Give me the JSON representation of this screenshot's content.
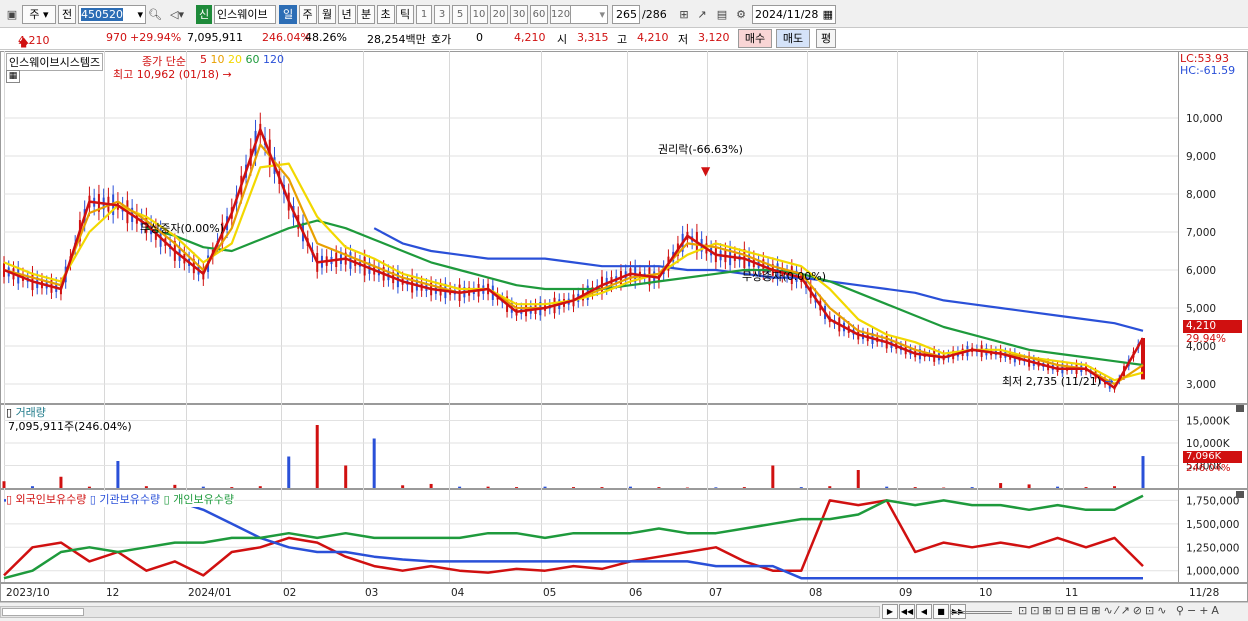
{
  "toolbar": {
    "market_select": "주",
    "prev_btn": "전",
    "code_value": "450520",
    "stock_badge": "신",
    "stock_name": "인스웨이브",
    "periods": [
      "일",
      "주",
      "월",
      "년",
      "분",
      "초",
      "틱"
    ],
    "period_selected": "일",
    "intervals": [
      "1",
      "3",
      "5",
      "10",
      "20",
      "30",
      "60",
      "120"
    ],
    "count": "265",
    "total": "/286",
    "date": "2024/11/28"
  },
  "quote": {
    "price": "4,210",
    "change": "970",
    "change_pct": "+29.94%",
    "volume": "7,095,911",
    "vol_ratio": "246.04%",
    "turnover": "48.26%",
    "amount": "28,254백만",
    "bid_label": "호가",
    "bid_val": "0",
    "bid_price": "4,210",
    "open_label": "시",
    "open_val": "3,315",
    "high_label": "고",
    "high_val": "4,210",
    "low_label": "저",
    "low_val": "3,120",
    "buy_btn": "매수",
    "sell_btn": "매도",
    "eval_btn": "평"
  },
  "price_panel": {
    "legend_name": "인스웨이브시스템즈",
    "legend_ma": "종가 단순",
    "ma_periods": [
      "5",
      "10",
      "20",
      "60",
      "120"
    ],
    "ma_colors": [
      "#d01010",
      "#e8a000",
      "#f2d800",
      "#1e9a3c",
      "#2a50d8"
    ],
    "lc": "LC:53.93",
    "hc": "HC:-61.59",
    "high_note": "최고 10,962 (01/18)",
    "low_note": "최저 2,735 (11/21)",
    "rights_note": "권리락(-66.63%)",
    "bonus_note1": "무상증자(0.00%)",
    "bonus_note2": "무상증자(0.00%)",
    "current_price_tag": "4,210",
    "current_pct_tag": "29.94%"
  },
  "volume_panel": {
    "legend_name": "거래량",
    "legend_value": "7,095,911주(246.04%)",
    "current_tag": "7,096K",
    "current_pct": "246.04%"
  },
  "holder_panel": {
    "legend_items": [
      "외국인보유수량",
      "기관보유수량",
      "개인보유수량"
    ],
    "legend_colors": [
      "#d01010",
      "#2a50d8",
      "#1e9a3c"
    ]
  },
  "chart_data": [
    {
      "type": "line",
      "title": "인스웨이브시스템즈",
      "ylim": [
        2500,
        11500
      ],
      "y_ticks": [
        "3,000",
        "4,000",
        "5,000",
        "6,000",
        "7,000",
        "8,000",
        "9,000",
        "10,000"
      ],
      "x_labels": [
        "2023/10",
        "12",
        "2024/01",
        "02",
        "03",
        "04",
        "05",
        "06",
        "07",
        "08",
        "09",
        "10",
        "11",
        "11/28"
      ],
      "series": [
        {
          "name": "5",
          "values": [
            6000,
            5700,
            5500,
            7800,
            7700,
            7200,
            6500,
            5900,
            7500,
            9700,
            7800,
            6200,
            6300,
            6000,
            5700,
            5500,
            5400,
            5500,
            4900,
            5000,
            5200,
            5600,
            5900,
            5800,
            6900,
            6400,
            6300,
            6000,
            5800,
            4700,
            4300,
            4100,
            3800,
            3700,
            3900,
            3800,
            3600,
            3400,
            3400,
            2900,
            4210
          ]
        },
        {
          "name": "10",
          "values": [
            6000,
            5800,
            5600,
            7500,
            7800,
            7300,
            6700,
            6000,
            7100,
            9300,
            8400,
            6700,
            6400,
            6100,
            5800,
            5600,
            5400,
            5500,
            5000,
            5000,
            5200,
            5500,
            5800,
            5900,
            6700,
            6600,
            6400,
            6100,
            5900,
            5000,
            4400,
            4200,
            3900,
            3700,
            3900,
            3800,
            3700,
            3500,
            3400,
            3000,
            3500
          ]
        },
        {
          "name": "20",
          "values": [
            6200,
            5900,
            5700,
            7000,
            7700,
            7400,
            6900,
            6200,
            6700,
            8700,
            8800,
            7400,
            6600,
            6300,
            5900,
            5700,
            5500,
            5500,
            5100,
            5100,
            5200,
            5400,
            5700,
            5900,
            6400,
            6700,
            6500,
            6300,
            6100,
            5500,
            4700,
            4300,
            4100,
            3800,
            3900,
            3900,
            3700,
            3600,
            3500,
            3100,
            3300
          ]
        },
        {
          "name": "60",
          "values": [
            null,
            null,
            null,
            null,
            null,
            7100,
            6900,
            6600,
            6500,
            6800,
            7100,
            7300,
            7100,
            6800,
            6500,
            6200,
            6000,
            5800,
            5600,
            5500,
            5500,
            5500,
            5600,
            5700,
            5800,
            5900,
            6000,
            6000,
            5900,
            5700,
            5400,
            5100,
            4800,
            4500,
            4300,
            4100,
            3900,
            3800,
            3700,
            3600,
            3500
          ]
        },
        {
          "name": "120",
          "values": [
            null,
            null,
            null,
            null,
            null,
            null,
            null,
            null,
            null,
            null,
            null,
            null,
            null,
            7100,
            6700,
            6500,
            6400,
            6300,
            6300,
            6300,
            6200,
            6100,
            6100,
            6100,
            6000,
            6000,
            5900,
            5800,
            5800,
            5700,
            5600,
            5500,
            5400,
            5200,
            5100,
            5000,
            4900,
            4800,
            4700,
            4600,
            4400
          ]
        }
      ]
    },
    {
      "type": "bar",
      "title": "거래량",
      "y_ticks": [
        "5,000K",
        "10,000K",
        "15,000K"
      ],
      "values_k": [
        1500,
        400,
        2500,
        300,
        6000,
        400,
        700,
        300,
        200,
        400,
        7000,
        14000,
        5000,
        11000,
        600,
        900,
        300,
        300,
        200,
        300,
        200,
        200,
        300,
        200,
        100,
        150,
        200,
        5000,
        200,
        400,
        4000,
        300,
        200,
        100,
        200,
        1100,
        800,
        300,
        200,
        400,
        7096
      ]
    },
    {
      "type": "line",
      "title": "외국인보유수량 / 기관보유수량 / 개인보유수량",
      "y_ticks": [
        "1,000,000",
        "1,250,000",
        "1,500,000",
        "1,750,000"
      ],
      "series": [
        {
          "name": "외국인보유수량",
          "values": [
            950000,
            1250000,
            1300000,
            1100000,
            1200000,
            1000000,
            1100000,
            950000,
            1200000,
            1250000,
            1350000,
            1300000,
            1150000,
            1050000,
            1000000,
            1050000,
            1000000,
            980000,
            1020000,
            1000000,
            1050000,
            1020000,
            1100000,
            1150000,
            1200000,
            1250000,
            1100000,
            1000000,
            1000000,
            1750000,
            1700000,
            1750000,
            1200000,
            1300000,
            1250000,
            1300000,
            1250000,
            1350000,
            1250000,
            1350000,
            1050000
          ]
        },
        {
          "name": "기관보유수량",
          "values": [
            1750000,
            1750000,
            1750000,
            1750000,
            1750000,
            1750000,
            1750000,
            1650000,
            1500000,
            1350000,
            1250000,
            1200000,
            1200000,
            1150000,
            1120000,
            1100000,
            1100000,
            1100000,
            1100000,
            1100000,
            1100000,
            1100000,
            1100000,
            1100000,
            1100000,
            1050000,
            1050000,
            1050000,
            920000,
            920000,
            920000,
            920000,
            920000,
            920000,
            920000,
            920000,
            920000,
            920000,
            920000,
            920000,
            920000
          ]
        },
        {
          "name": "개인보유수량",
          "values": [
            920000,
            1000000,
            1200000,
            1250000,
            1200000,
            1250000,
            1300000,
            1300000,
            1350000,
            1350000,
            1400000,
            1350000,
            1400000,
            1350000,
            1350000,
            1350000,
            1350000,
            1400000,
            1400000,
            1350000,
            1400000,
            1400000,
            1400000,
            1450000,
            1400000,
            1400000,
            1450000,
            1500000,
            1550000,
            1550000,
            1600000,
            1750000,
            1700000,
            1750000,
            1700000,
            1700000,
            1650000,
            1700000,
            1650000,
            1650000,
            1800000
          ]
        }
      ]
    }
  ],
  "bottom": {
    "buttons": [
      "▶",
      "◀◀",
      "◀",
      "■",
      "▶▶"
    ]
  }
}
